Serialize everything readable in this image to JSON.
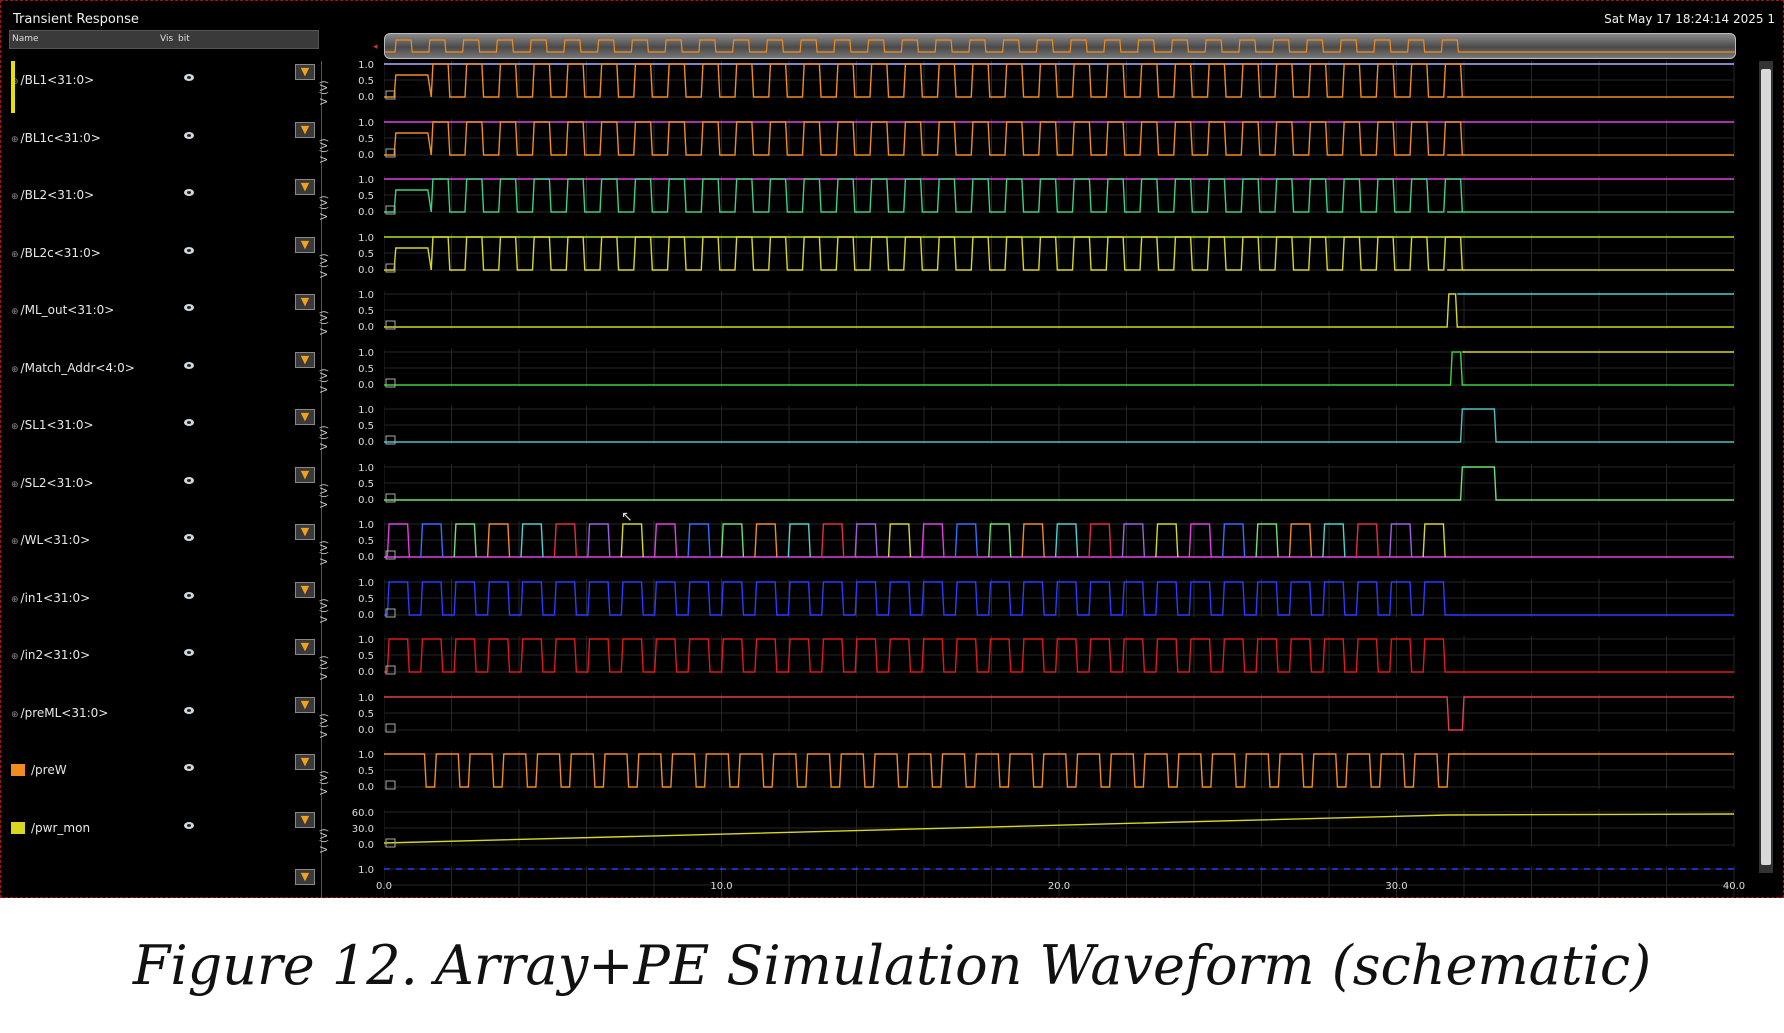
{
  "window": {
    "title": "Transient Response",
    "datetime": "Sat May 17 18:24:14 2025  1"
  },
  "columns": {
    "name": "Name",
    "vis": "Vis",
    "bit": "bit"
  },
  "yaxis_unit": "V (V)",
  "signals": [
    {
      "name": "/BL1<31:0>",
      "ticks": [
        "1.0",
        "0.5",
        "0.0"
      ],
      "colors": [
        "#f28c1e",
        "#b0b0ff"
      ]
    },
    {
      "name": "/BL1c<31:0>",
      "ticks": [
        "1.0",
        "0.5",
        "0.0"
      ],
      "colors": [
        "#f28c1e",
        "#e040e0"
      ]
    },
    {
      "name": "/BL2<31:0>",
      "ticks": [
        "1.0",
        "0.5",
        "0.0"
      ],
      "colors": [
        "#3fd080",
        "#e040e0"
      ]
    },
    {
      "name": "/BL2c<31:0>",
      "ticks": [
        "1.0",
        "0.5",
        "0.0"
      ],
      "colors": [
        "#d8d820",
        "#b0e020"
      ]
    },
    {
      "name": "/ML_out<31:0>",
      "ticks": [
        "1.0",
        "0.5",
        "0.0"
      ],
      "colors": [
        "#50d0d0",
        "#d8d820"
      ]
    },
    {
      "name": "/Match_Addr<4:0>",
      "ticks": [
        "1.0",
        "0.5",
        "0.0"
      ],
      "colors": [
        "#d8d820",
        "#40d040"
      ]
    },
    {
      "name": "/SL1<31:0>",
      "ticks": [
        "1.0",
        "0.5",
        "0.0"
      ],
      "colors": [
        "#50c0c0"
      ]
    },
    {
      "name": "/SL2<31:0>",
      "ticks": [
        "1.0",
        "0.5",
        "0.0"
      ],
      "colors": [
        "#70e070"
      ]
    },
    {
      "name": "/WL<31:0>",
      "ticks": [
        "1.0",
        "0.5",
        "0.0"
      ],
      "colors": [
        "#e040e0",
        "#3070ff",
        "#70e070",
        "#f28c1e",
        "#50d0d0",
        "#e03040",
        "#a060e0",
        "#d8d820"
      ]
    },
    {
      "name": "/in1<31:0>",
      "ticks": [
        "1.0",
        "0.5",
        "0.0"
      ],
      "colors": [
        "#2a3cff"
      ]
    },
    {
      "name": "/in2<31:0>",
      "ticks": [
        "1.0",
        "0.5",
        "0.0"
      ],
      "colors": [
        "#e01a1a"
      ]
    },
    {
      "name": "/preML<31:0>",
      "ticks": [
        "1.0",
        "0.5",
        "0.0"
      ],
      "colors": [
        "#e04040"
      ]
    },
    {
      "name": "/preW",
      "ticks": [
        "1.0",
        "0.5",
        "0.0"
      ],
      "colors": [
        "#f28c1e"
      ],
      "swatch": "#f28c1e"
    },
    {
      "name": "/pwr_mon",
      "ticks": [
        "60.0",
        "30.0",
        "0.0"
      ],
      "colors": [
        "#d8d820"
      ],
      "swatch": "#d8d820"
    },
    {
      "name": "",
      "ticks": [
        "1.0"
      ],
      "colors": [
        "#2a3cff"
      ]
    }
  ],
  "xaxis": {
    "ticks": [
      "0.0",
      "10.0",
      "20.0",
      "30.0",
      "40.0"
    ]
  },
  "caption": "Figure 12. Array+PE Simulation Waveform (schematic)"
}
